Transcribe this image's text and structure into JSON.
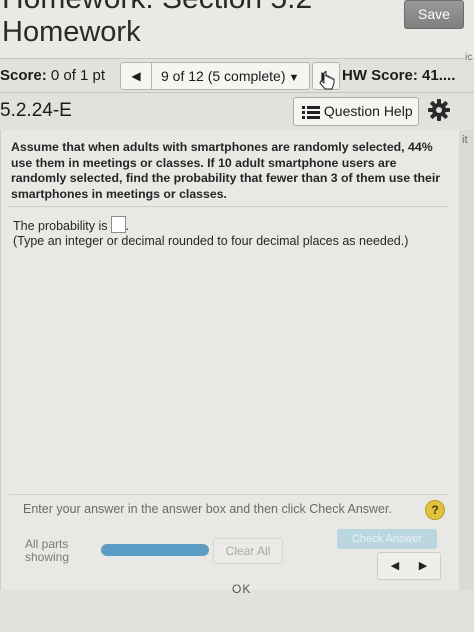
{
  "header": {
    "cut_title": "Homework: Section 5.2",
    "title": "Homework",
    "save_label": "Save"
  },
  "score_bar": {
    "score_label": "Score:",
    "score_value": "0 of 1 pt",
    "nav_label": "9 of 12 (5 complete)",
    "hw_score_label": "HW Score: 41...."
  },
  "question_header": {
    "id": "5.2.24-E",
    "help_label": "Question Help"
  },
  "question": {
    "text": "Assume that when adults with smartphones are randomly selected, 44% use them in meetings or classes. If 10 adult smartphone users are randomly selected, find the probability that fewer than 3 of them use their smartphones in meetings or classes.",
    "answer_prefix": "The probability is",
    "answer_suffix": ".",
    "answer_value": "",
    "note": "(Type an integer or decimal rounded to four decimal places as needed.)"
  },
  "footer": {
    "instruction": "Enter your answer in the answer box and then click Check Answer.",
    "hint_glyph": "?",
    "parts_label_1": "All parts",
    "parts_label_2": "showing",
    "progress_fraction": 1.0,
    "clear_label": "Clear All",
    "check_label": "Check Answer",
    "ok_peek": "OK"
  },
  "side": {
    "ic": "ic",
    "it": "it"
  },
  "colors": {
    "progress": "#5b9dc4",
    "hint": "#e2c23c",
    "save_button": "#8a8a8a"
  },
  "icons": [
    "mouse-pointer-icon",
    "list-icon",
    "gear-icon",
    "help-hint-icon",
    "triangle-left-icon",
    "triangle-right-icon"
  ]
}
